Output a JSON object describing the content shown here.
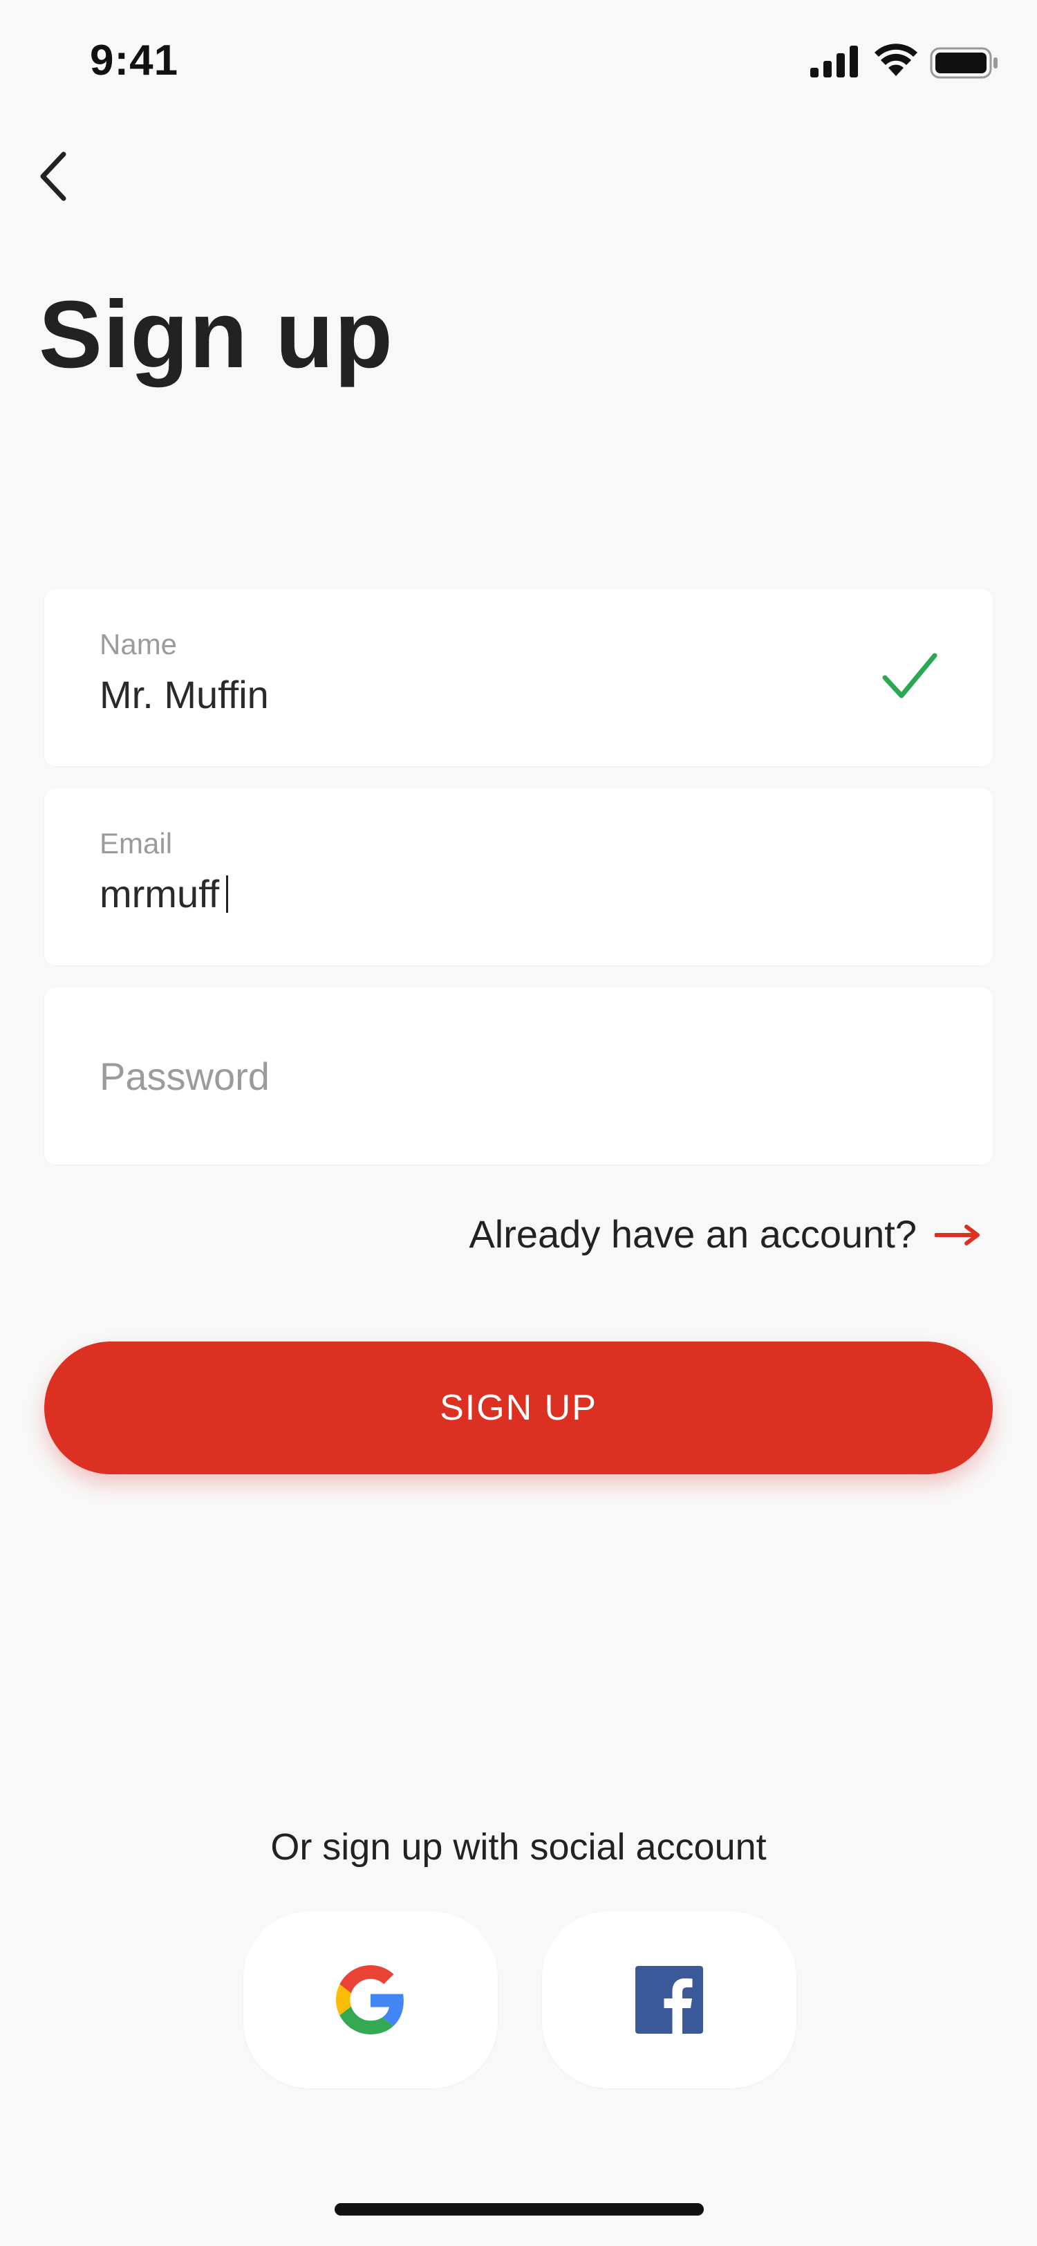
{
  "status_bar": {
    "time": "9:41"
  },
  "header": {
    "title": "Sign up"
  },
  "form": {
    "name": {
      "label": "Name",
      "value": "Mr. Muffin",
      "valid": true
    },
    "email": {
      "label": "Email",
      "value": "mrmuff"
    },
    "password": {
      "placeholder": "Password",
      "value": ""
    }
  },
  "login_link": {
    "text": "Already have an account?"
  },
  "signup_button": {
    "label": "SIGN UP"
  },
  "social": {
    "label": "Or sign up with social account",
    "providers": [
      "google-icon",
      "facebook-icon"
    ]
  },
  "colors": {
    "accent": "#db3022",
    "success": "#2aa952",
    "background": "#f8f8f8",
    "facebook": "#3b5998"
  }
}
